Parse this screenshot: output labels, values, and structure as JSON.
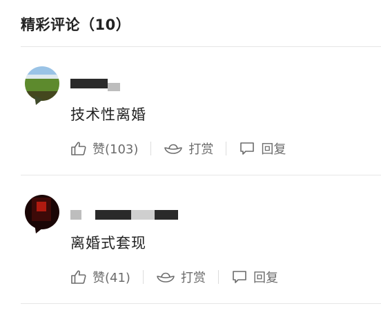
{
  "section": {
    "title": "精彩评论（10）"
  },
  "comments": [
    {
      "text": "技术性离婚",
      "like_label": "赞(103)",
      "reward_label": "打赏",
      "reply_label": "回复",
      "like_icon": "thumbs-up-icon",
      "reward_icon": "ingot-icon",
      "reply_icon": "speech-bubble-icon"
    },
    {
      "text": "离婚式套现",
      "like_label": "赞(41)",
      "reward_label": "打赏",
      "reply_label": "回复",
      "like_icon": "thumbs-up-icon",
      "reward_icon": "ingot-icon",
      "reply_icon": "speech-bubble-icon"
    }
  ],
  "colors": {
    "title": "#222222",
    "body_text": "#222222",
    "action_text": "#6b6b6b",
    "divider": "#e6e6e6"
  }
}
